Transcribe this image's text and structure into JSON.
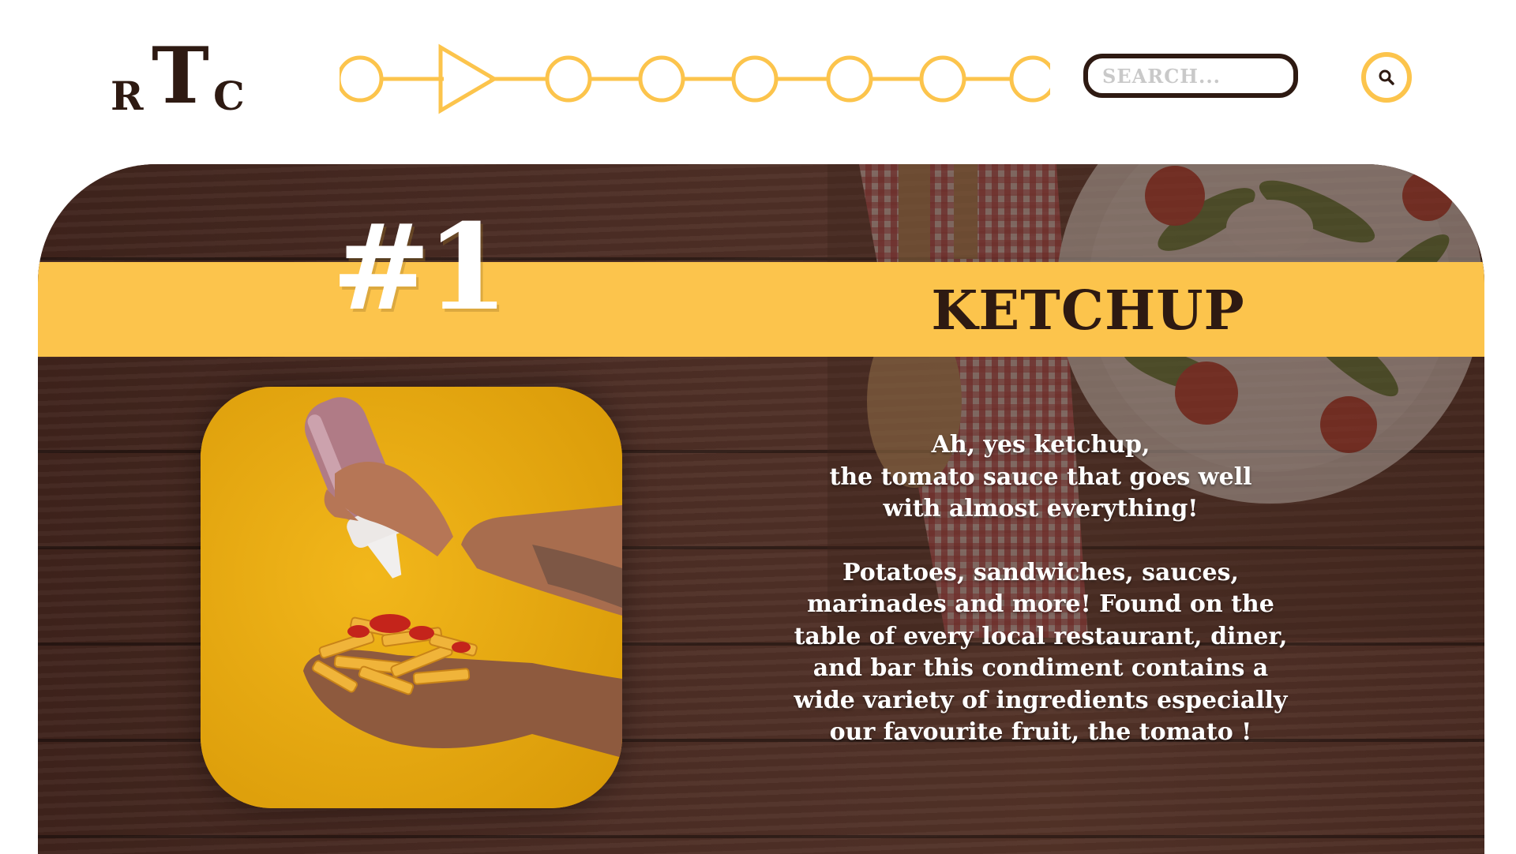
{
  "header": {
    "logo": {
      "letter_left": "R",
      "letter_middle": "T",
      "letter_right": "C"
    },
    "stepper": {
      "step_count": 8,
      "active_step": 2,
      "accent_color": "#fcc44c"
    },
    "search": {
      "placeholder": "SEARCH...",
      "value": "",
      "button_icon": "search-icon"
    }
  },
  "hero": {
    "rank": "#1",
    "title": "KETCHUP",
    "description": [
      "Ah, yes ketchup,\nthe tomato sauce that goes well\nwith almost everything!",
      "Potatoes, sandwiches, sauces,\nmarinades and more! Found on the\ntable of every local restaurant, diner,\nand bar this condiment contains a\nwide variety of ingredients especially\nour favourite fruit, the tomato !"
    ],
    "image": "hands-ketchup-fries-photo"
  },
  "colors": {
    "accent": "#fcc44c",
    "dark_brown": "#2e1a12",
    "wood": "#4a2c24",
    "text_light": "#ffffff"
  }
}
